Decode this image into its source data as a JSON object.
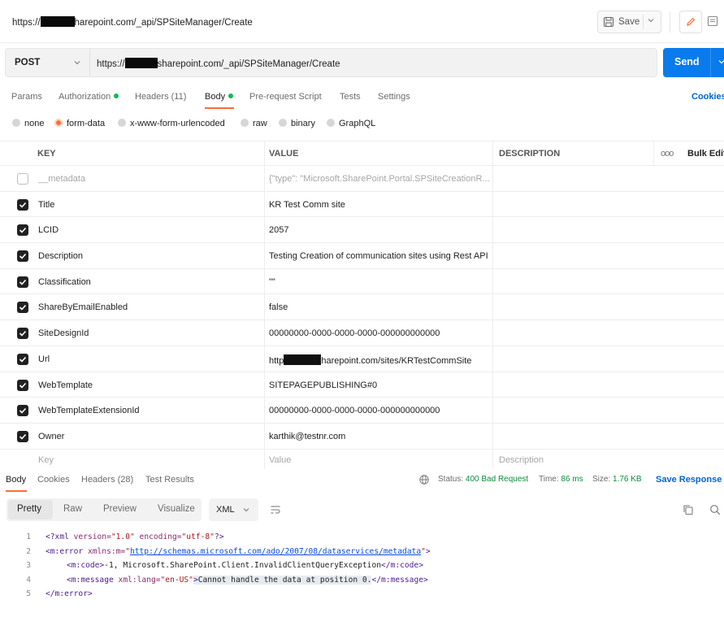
{
  "header": {
    "tab_url_prefix": "https://",
    "tab_url_suffix": "harepoint.com/_api/SPSiteManager/Create",
    "save_label": "Save"
  },
  "request": {
    "method": "POST",
    "url_prefix": "https://",
    "url_suffix": "sharepoint.com/_api/SPSiteManager/Create",
    "send_label": "Send"
  },
  "request_tabs": [
    {
      "label": "Params"
    },
    {
      "label": "Authorization"
    },
    {
      "label": "Headers (11)"
    },
    {
      "label": "Body"
    },
    {
      "label": "Pre-request Script"
    },
    {
      "label": "Tests"
    },
    {
      "label": "Settings"
    }
  ],
  "cookies_label": "Cookies",
  "body_types": [
    {
      "label": "none"
    },
    {
      "label": "form-data"
    },
    {
      "label": "x-www-form-urlencoded"
    },
    {
      "label": "raw"
    },
    {
      "label": "binary"
    },
    {
      "label": "GraphQL"
    }
  ],
  "table": {
    "headers": {
      "key": "KEY",
      "value": "VALUE",
      "description": "DESCRIPTION",
      "more": "ooo",
      "bulk_edit": "Bulk Edit"
    },
    "rows": [
      {
        "key": "__metadata",
        "value": "{\"type\": \"Microsoft.SharePoint.Portal.SPSiteCreationR...",
        "checked": false
      },
      {
        "key": "Title",
        "value": "KR Test Comm site",
        "checked": true
      },
      {
        "key": "LCID",
        "value": "2057",
        "checked": true
      },
      {
        "key": "Description",
        "value": "Testing Creation of communication sites using Rest API",
        "checked": true
      },
      {
        "key": "Classification",
        "value": "\"\"",
        "checked": true
      },
      {
        "key": "ShareByEmailEnabled",
        "value": "false",
        "checked": true
      },
      {
        "key": "SiteDesignId",
        "value": "00000000-0000-0000-0000-000000000000",
        "checked": true
      },
      {
        "key": "Url",
        "value_prefix": "http",
        "value_suffix": "harepoint.com/sites/KRTestCommSite",
        "checked": true
      },
      {
        "key": "WebTemplate",
        "value": "SITEPAGEPUBLISHING#0",
        "checked": true
      },
      {
        "key": "WebTemplateExtensionId",
        "value": "00000000-0000-0000-0000-000000000000",
        "checked": true
      },
      {
        "key": "Owner",
        "value": "karthik@testnr.com",
        "checked": true
      }
    ],
    "placeholders": {
      "key": "Key",
      "value": "Value",
      "description": "Description"
    }
  },
  "response": {
    "tabs": [
      {
        "label": "Body"
      },
      {
        "label": "Cookies"
      },
      {
        "label": "Headers (28)"
      },
      {
        "label": "Test Results"
      }
    ],
    "status_label": "Status:",
    "status_value": "400 Bad Request",
    "time_label": "Time:",
    "time_value": "86 ms",
    "size_label": "Size:",
    "size_value": "1.76 KB",
    "save_response_label": "Save Response",
    "views": [
      {
        "label": "Pretty"
      },
      {
        "label": "Raw"
      },
      {
        "label": "Preview"
      },
      {
        "label": "Visualize"
      }
    ],
    "format": "XML",
    "code": {
      "line_numbers": [
        "1",
        "2",
        "3",
        "4",
        "5"
      ],
      "l1_decl_open": "<?xml ",
      "l1_attr1": "version=",
      "l1_val1": "\"1.0\"",
      "l1_attr2": " encoding=",
      "l1_val2": "\"utf-8\"",
      "l1_close": "?>",
      "l2_open": "<m:error ",
      "l2_attr": "xmlns:m=",
      "l2_q1": "\"",
      "l2_url": "http://schemas.microsoft.com/ado/2007/08/dataservices/metadata",
      "l2_q2": "\"",
      "l2_close": ">",
      "l3_open": "<m:code>",
      "l3_text": "-1, Microsoft.SharePoint.Client.InvalidClientQueryException",
      "l3_close": "</m:code>",
      "l4_open": "<m:message ",
      "l4_attr": "xml:lang=",
      "l4_val": "\"en-US\"",
      "l4_gt": ">",
      "l4_text": "Cannot handle the data at position 0.",
      "l4_close": "</m:message>",
      "l5": "</m:error>"
    }
  },
  "colors": {
    "accent": "#ff6c37",
    "send": "#097bed",
    "link": "#0265d2",
    "status_ok_dot": "#0cbb52"
  },
  "icons": [
    "save-icon",
    "chevron-down-icon",
    "pencil-icon",
    "comment-icon",
    "globe-icon",
    "wrap-lines-icon",
    "copy-icon",
    "search-icon",
    "checkbox-checked-icon"
  ]
}
